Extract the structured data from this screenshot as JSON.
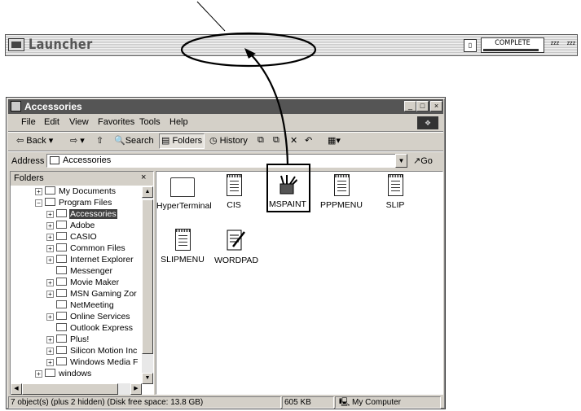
{
  "launcher": {
    "title": "Launcher",
    "status": "COMPLETE",
    "progress_fraction": 0.95,
    "sleep_labels": [
      "zzz",
      "zzz"
    ]
  },
  "window": {
    "title": "Accessories",
    "controls": [
      "_",
      "□",
      "×"
    ],
    "menu": [
      "File",
      "Edit",
      "View",
      "Favorites",
      "Tools",
      "Help"
    ],
    "toolbar": {
      "back": "Back",
      "search": "Search",
      "folders": "Folders",
      "history": "History"
    },
    "address": {
      "label": "Address",
      "value": "Accessories",
      "go": "Go"
    },
    "folders_pane": {
      "title": "Folders",
      "close": "×",
      "tree": [
        {
          "label": "My Documents",
          "expander": "+",
          "selected": false
        },
        {
          "label": "Program Files",
          "expander": "−",
          "selected": false
        },
        {
          "label": "Accessories",
          "expander": "+",
          "selected": true
        },
        {
          "label": "Adobe",
          "expander": "+",
          "selected": false
        },
        {
          "label": "CASIO",
          "expander": "+",
          "selected": false
        },
        {
          "label": "Common Files",
          "expander": "+",
          "selected": false
        },
        {
          "label": "Internet Explorer",
          "expander": "+",
          "selected": false
        },
        {
          "label": "Messenger",
          "expander": "",
          "selected": false
        },
        {
          "label": "Movie Maker",
          "expander": "+",
          "selected": false
        },
        {
          "label": "MSN Gaming Zor",
          "expander": "+",
          "selected": false
        },
        {
          "label": "NetMeeting",
          "expander": "",
          "selected": false
        },
        {
          "label": "Online Services",
          "expander": "+",
          "selected": false
        },
        {
          "label": "Outlook Express",
          "expander": "",
          "selected": false
        },
        {
          "label": "Plus!",
          "expander": "+",
          "selected": false
        },
        {
          "label": "Silicon Motion Inc",
          "expander": "+",
          "selected": false
        },
        {
          "label": "Windows Media F",
          "expander": "+",
          "selected": false
        },
        {
          "label": "windows",
          "expander": "+",
          "selected": false
        }
      ]
    },
    "files": [
      {
        "label": "HyperTerminal",
        "icon": "folder-icon"
      },
      {
        "label": "CIS",
        "icon": "document-icon"
      },
      {
        "label": "MSPAINT",
        "icon": "paint-icon"
      },
      {
        "label": "PPPMENU",
        "icon": "document-icon"
      },
      {
        "label": "SLIP",
        "icon": "document-icon"
      },
      {
        "label": "SLIPMENU",
        "icon": "document-icon"
      },
      {
        "label": "WORDPAD",
        "icon": "wordpad-icon"
      }
    ],
    "statusbar": {
      "objects": "7 object(s) (plus 2 hidden) (Disk free space: 13.8 GB)",
      "size": "605 KB",
      "location": "My Computer"
    }
  }
}
